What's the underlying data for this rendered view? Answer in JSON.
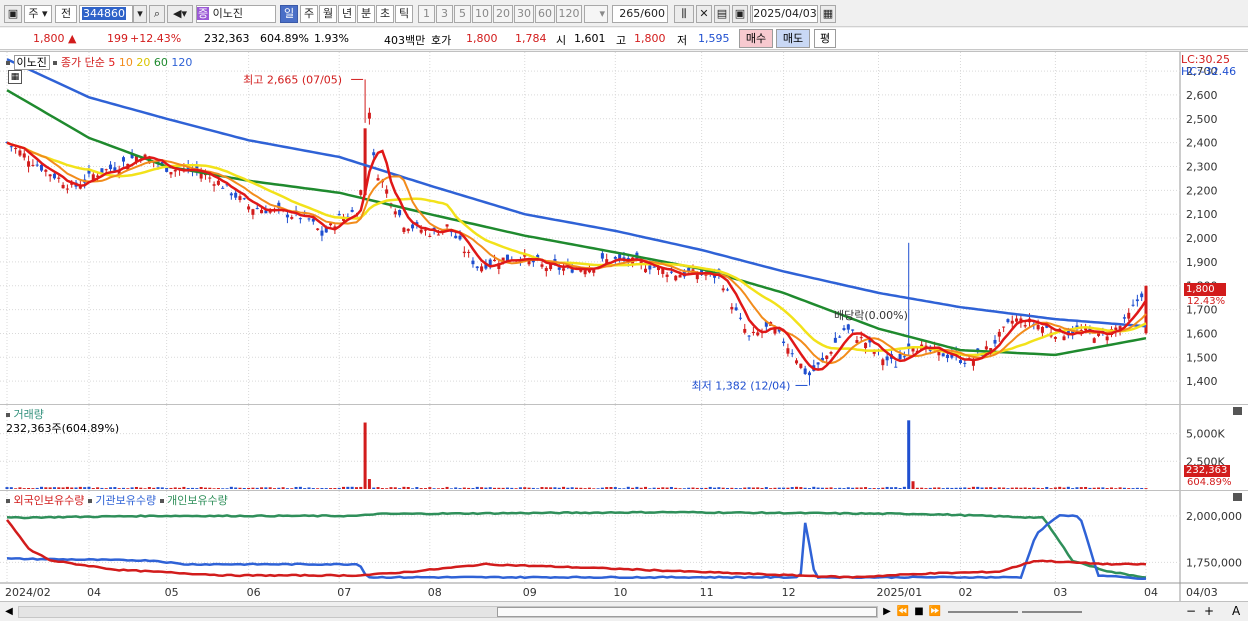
{
  "toolbar": {
    "market_label": "주",
    "prev_label": "전",
    "stock_code": "344860",
    "stock_badge": "증",
    "stock_name": "이노진",
    "period_day": "일",
    "period_week": "주",
    "period_month": "월",
    "period_year": "년",
    "period_min": "분",
    "period_sec": "초",
    "period_tick": "틱",
    "intervals": [
      "1",
      "3",
      "5",
      "10",
      "20",
      "30",
      "60",
      "120"
    ],
    "count": "265",
    "count_max": "/600",
    "date": "2025/04/03"
  },
  "quote": {
    "price": "1,800",
    "change_arrow": "▲",
    "change": "199",
    "change_pct": "+12.43%",
    "volume": "232,363",
    "volume_pct": "604.89%",
    "turnover": "1.93%",
    "trade_value": "403백만",
    "ask_label": "호가",
    "ask1": "1,800",
    "ask2": "1,784",
    "open_label": "시",
    "open": "1,601",
    "high_label": "고",
    "high": "1,800",
    "low_label": "저",
    "low": "1,595",
    "buy_label": "매수",
    "sell_label": "매도",
    "eval_label": "평"
  },
  "price_panel": {
    "legend_name": "이노진",
    "legend_type": "종가 단순",
    "ma_labels": [
      "5",
      "10",
      "20",
      "60",
      "120"
    ],
    "lc_label": "LC:30.25",
    "hc_label": "HC:-32.46",
    "last_price_tag": "1,800",
    "last_pct_tag": "12.43%",
    "high_annotation": "최고 2,665 (07/05)",
    "low_annotation": "최저 1,382 (12/04)",
    "dividend_annotation": "배당락(0.00%)",
    "y_ticks": [
      "2,700",
      "2,600",
      "2,500",
      "2,400",
      "2,300",
      "2,200",
      "2,100",
      "2,000",
      "1,900",
      "1,800",
      "1,700",
      "1,600",
      "1,500",
      "1,400"
    ]
  },
  "volume_panel": {
    "title": "거래량",
    "value_label": "232,363주(604.89%)",
    "y_ticks": [
      "5,000K",
      "2,500K"
    ],
    "last_tag": "232,363",
    "last_pct_tag": "604.89%"
  },
  "holdings_panel": {
    "series_labels": [
      "외국인보유수량",
      "기관보유수량",
      "개인보유수량"
    ],
    "y_ticks": [
      "2,000,000",
      "1,750,000"
    ]
  },
  "x_axis": {
    "labels": [
      "2024/02",
      "04",
      "05",
      "06",
      "07",
      "08",
      "09",
      "10",
      "11",
      "12",
      "2025/01",
      "02",
      "03",
      "04"
    ],
    "right_label": "04/03"
  },
  "colors": {
    "up": "#d21c1c",
    "down": "#1f4fd0",
    "ma5": "#e01818",
    "ma10": "#f28c1c",
    "ma20": "#f2e21a",
    "ma60": "#1f8a2e",
    "ma120": "#2f62d6",
    "foreign": "#d21c1c",
    "institution": "#2f62d6",
    "individual": "#2f8f5a"
  },
  "chart_data": {
    "type": "line",
    "title": "이노진",
    "x_label": "",
    "y_label": "",
    "ylim": [
      1300,
      2780
    ],
    "x_ticks": [
      "2024/02",
      "04",
      "05",
      "06",
      "07",
      "08",
      "09",
      "10",
      "11",
      "12",
      "2025/01",
      "02",
      "03",
      "04"
    ],
    "series": [
      {
        "name": "종가",
        "x": [
          "2024/02",
          "04",
          "05",
          "06",
          "07/05",
          "08",
          "09",
          "10",
          "11",
          "12/04",
          "2025/01",
          "02",
          "03",
          "04/03"
        ],
        "values": [
          2400,
          2330,
          2280,
          2100,
          2665,
          1990,
          1920,
          1870,
          1800,
          1382,
          1500,
          1520,
          1640,
          1800
        ]
      },
      {
        "name": "120",
        "x": [
          "2024/02",
          "04",
          "05",
          "06",
          "07",
          "08",
          "09",
          "10",
          "11",
          "12",
          "2025/01",
          "02",
          "03",
          "04/03"
        ],
        "values": [
          2750,
          2590,
          2500,
          2410,
          2340,
          2220,
          2100,
          2030,
          1950,
          1860,
          1770,
          1710,
          1660,
          1630
        ]
      },
      {
        "name": "60",
        "x": [
          "2024/02",
          "04",
          "05",
          "06",
          "07",
          "08",
          "09",
          "10",
          "11",
          "12",
          "2025/01",
          "02",
          "03",
          "04/03"
        ],
        "values": [
          2620,
          2420,
          2300,
          2240,
          2190,
          2100,
          2010,
          1940,
          1870,
          1770,
          1620,
          1530,
          1510,
          1580
        ]
      }
    ]
  }
}
